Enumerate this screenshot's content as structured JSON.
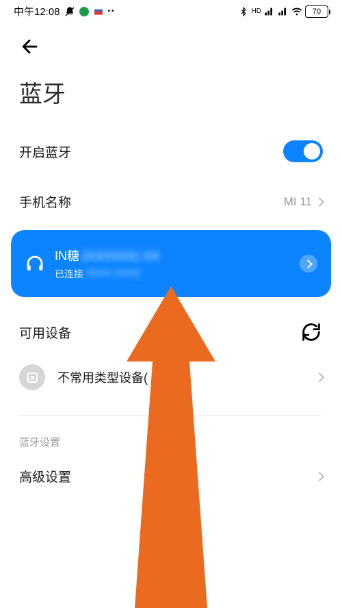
{
  "status": {
    "time": "中午12:08",
    "battery": "70"
  },
  "page": {
    "title": "蓝牙"
  },
  "bt_switch": {
    "label": "开启蓝牙"
  },
  "phone_name": {
    "label": "手机名称",
    "value": "MI 11"
  },
  "connected_device": {
    "name_visible": "IN糖",
    "name_obscured": "(XXXXXX) XX",
    "status": "已连接",
    "status_obscured": "XXXX (XXX)"
  },
  "available": {
    "label": "可用设备"
  },
  "uncommon": {
    "label": "不常用类型设备("
  },
  "bt_settings_section": "蓝牙设置",
  "advanced": {
    "label": "高级设置"
  }
}
